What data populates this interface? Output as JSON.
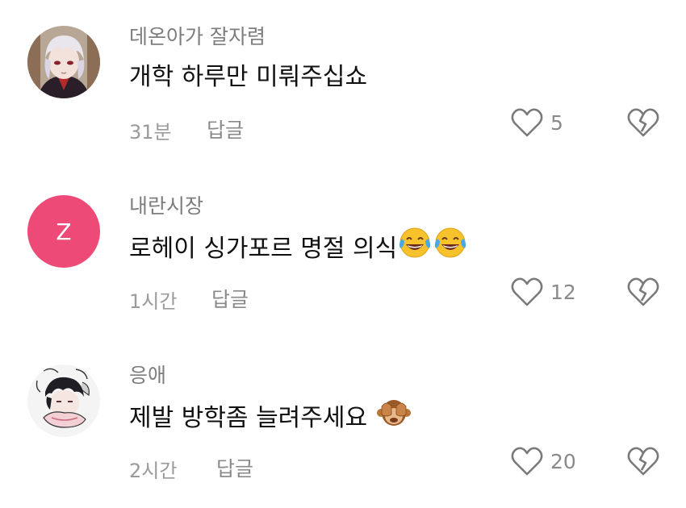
{
  "comments": [
    {
      "username": "데온아가 잘자렴",
      "text": "개학 하루만 미뤄주십쇼",
      "time": "31분",
      "reply_label": "답글",
      "likes": "5",
      "avatar_icon": "anime-avatar-white-hair"
    },
    {
      "username": "내란시장",
      "text": "로헤이 싱가포르 명절 의식",
      "time": "1시간",
      "reply_label": "답글",
      "likes": "12",
      "avatar_letter": "Z",
      "avatar_color": "#ee4a78",
      "emoji_icon": "face-with-tears-of-joy-icon"
    },
    {
      "username": "응애",
      "text": "제발 방학좀 늘려주세요",
      "time": "2시간",
      "reply_label": "답글",
      "likes": "20",
      "avatar_icon": "anime-avatar-sketch",
      "emoji_icon": "see-no-evil-monkey-icon"
    }
  ],
  "icons": {
    "like": "heart-outline-icon",
    "dislike": "broken-heart-icon"
  },
  "colors": {
    "text": "#111111",
    "secondary": "#7d7d7d",
    "icon": "#7a7a7a"
  }
}
